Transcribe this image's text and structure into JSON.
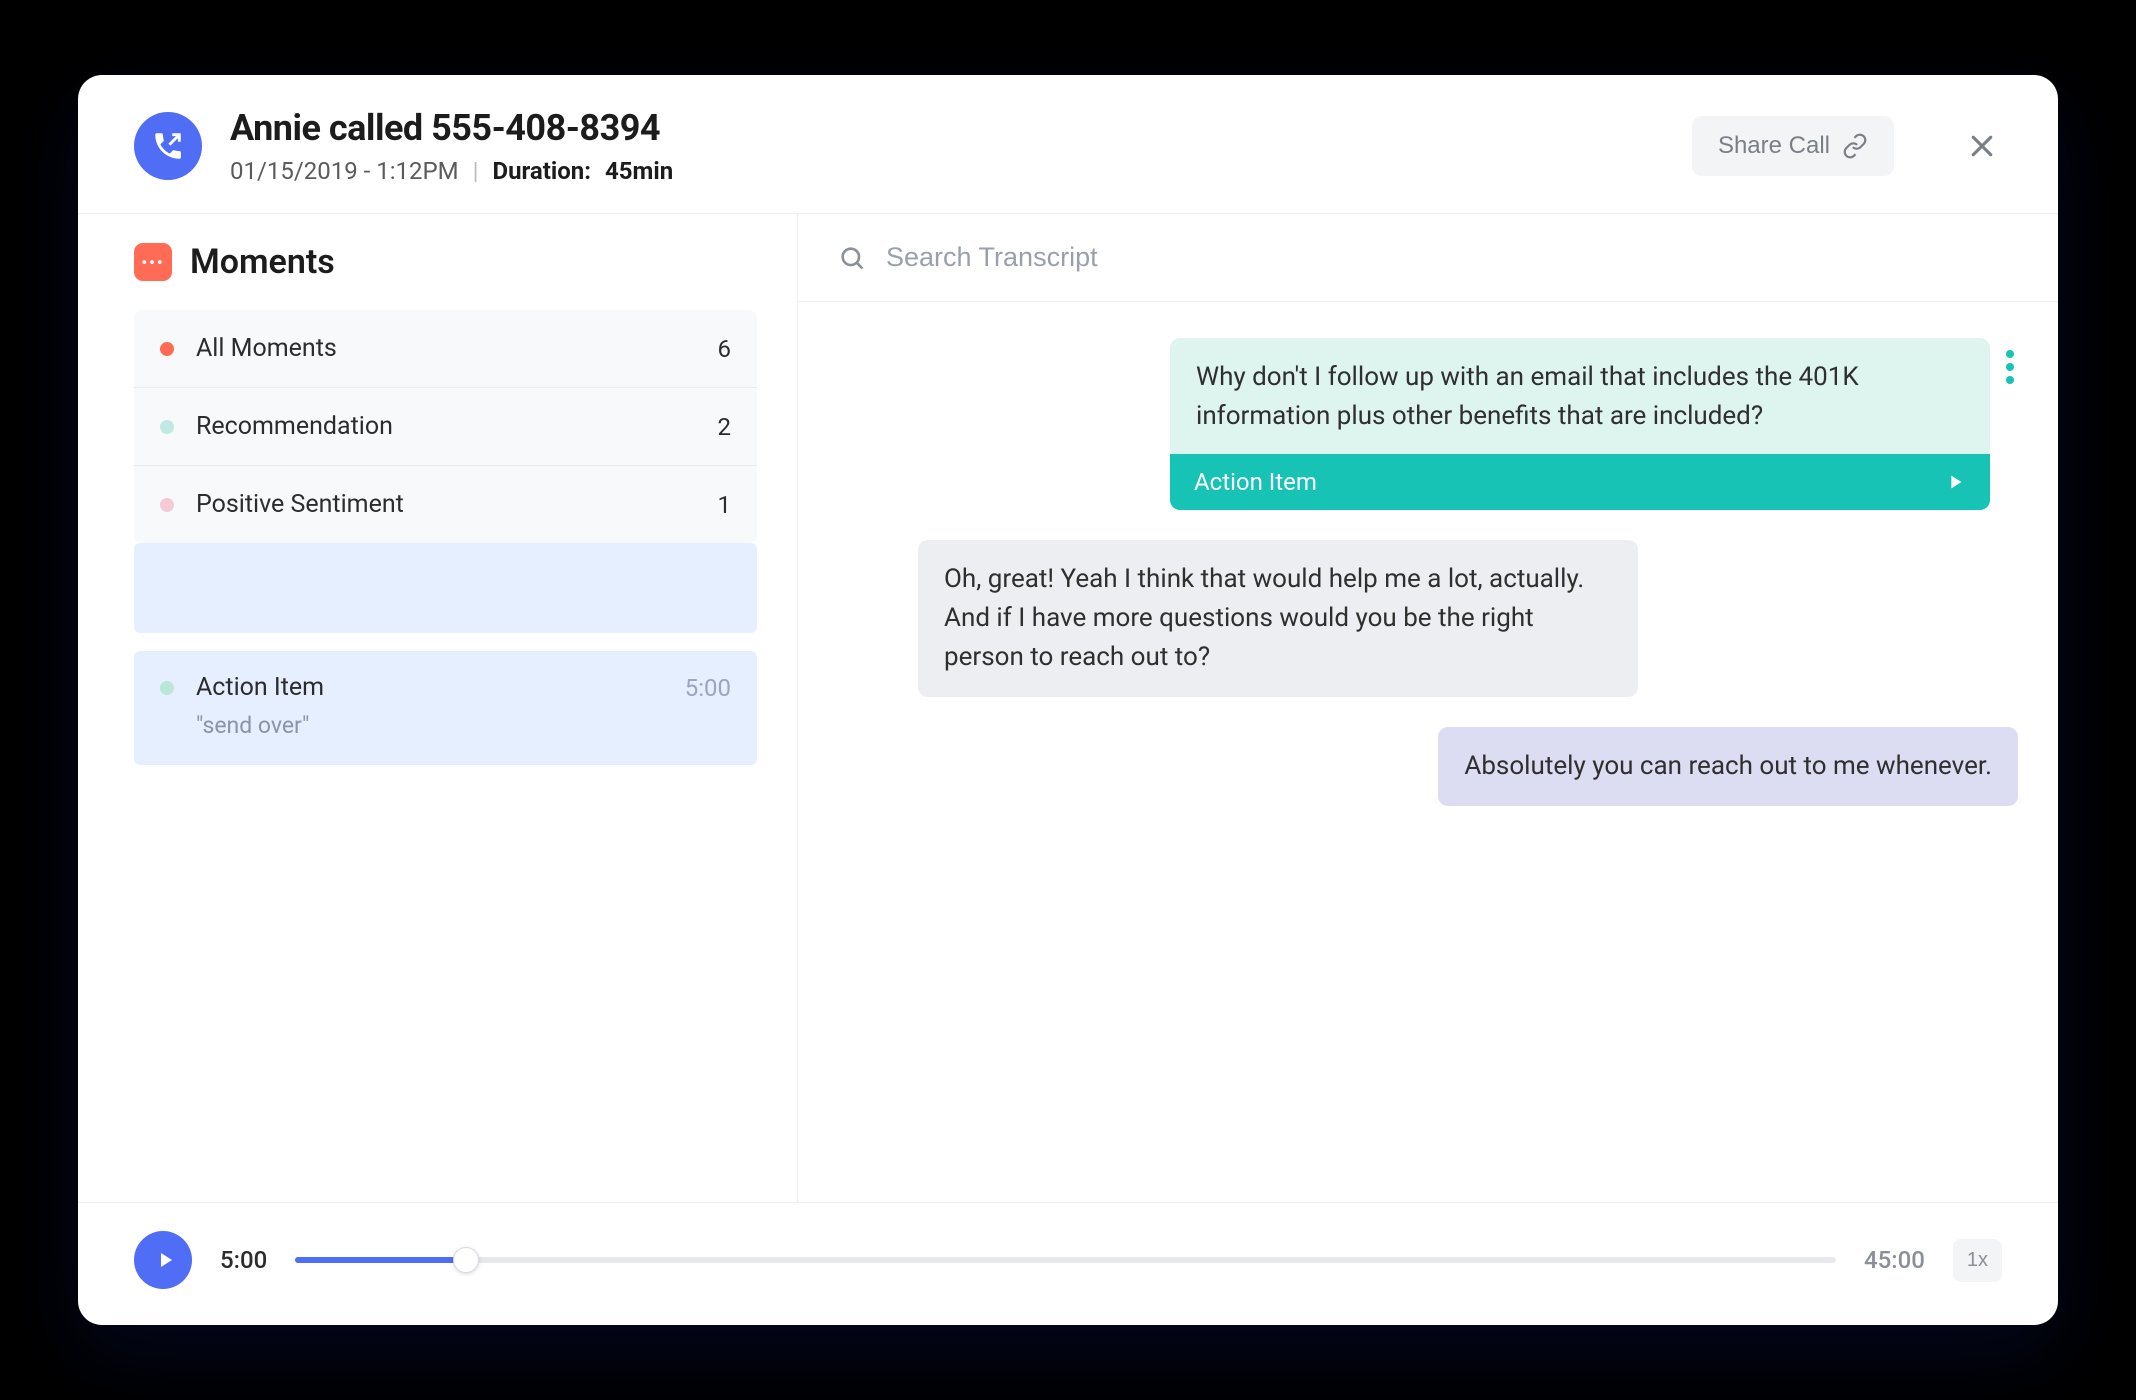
{
  "header": {
    "title": "Annie called 555-408-8394",
    "datetime": "01/15/2019 - 1:12PM",
    "duration_label": "Duration:",
    "duration_value": "45min",
    "share_label": "Share Call"
  },
  "sidebar": {
    "title": "Moments",
    "filters": [
      {
        "label": "All Moments",
        "count": "6",
        "color": "#ff6b55"
      },
      {
        "label": "Recommendation",
        "count": "2",
        "color": "#bfe9e2"
      },
      {
        "label": "Positive Sentiment",
        "count": "1",
        "color": "#f6c9d6"
      }
    ],
    "action_item": {
      "label": "Action Item",
      "time": "5:00",
      "subtitle": "\"send over\"",
      "dot_color": "#b9e8d7"
    }
  },
  "search": {
    "placeholder": "Search Transcript"
  },
  "transcript": {
    "msg1": "Why don't I follow up with an email that includes the 401K information plus other benefits that are included?",
    "msg1_tag": "Action Item",
    "msg2": "Oh, great! Yeah I think that would help me a lot, actually. And if I have more questions would you be the right person to reach out to?",
    "msg3": "Absolutely you can reach out to me whenever."
  },
  "player": {
    "current": "5:00",
    "total": "45:00",
    "speed": "1x",
    "progress_pct": 11.1
  }
}
